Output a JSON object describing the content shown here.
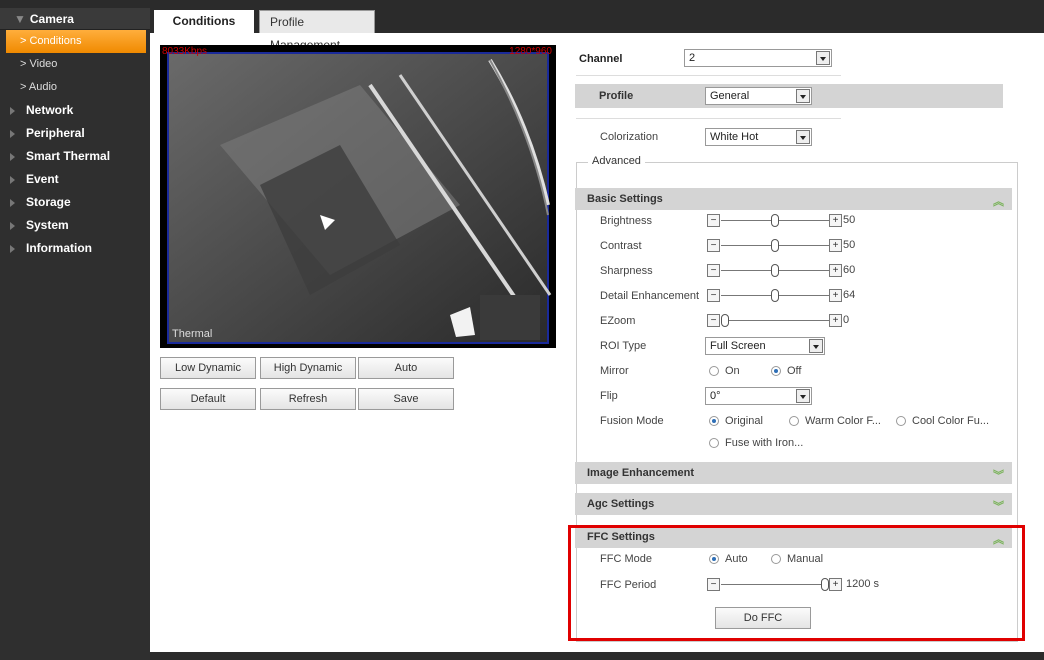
{
  "sidebar": {
    "header": "Camera",
    "subs": [
      "Conditions",
      "Video",
      "Audio"
    ],
    "items": [
      "Network",
      "Peripheral",
      "Smart Thermal",
      "Event",
      "Storage",
      "System",
      "Information"
    ]
  },
  "tabs": {
    "active": "Conditions",
    "inactive": "Profile Management"
  },
  "video": {
    "label": "Thermal",
    "bitrate": "8033Kbps",
    "resolution": "1280*960"
  },
  "video_buttons": {
    "low_dynamic": "Low Dynamic",
    "high_dynamic": "High Dynamic",
    "auto": "Auto",
    "default": "Default",
    "refresh": "Refresh",
    "save": "Save"
  },
  "form": {
    "channel_label": "Channel",
    "channel_value": "2",
    "profile_label": "Profile",
    "profile_value": "General",
    "colorization_label": "Colorization",
    "colorization_value": "White Hot",
    "advanced_legend": "Advanced"
  },
  "basic": {
    "title": "Basic Settings",
    "brightness": {
      "label": "Brightness",
      "value": "50",
      "level": 0.5
    },
    "contrast": {
      "label": "Contrast",
      "value": "50",
      "level": 0.5
    },
    "sharpness": {
      "label": "Sharpness",
      "value": "60",
      "level": 0.5
    },
    "detail": {
      "label": "Detail Enhancement",
      "value": "64",
      "level": 0.5
    },
    "ezoom": {
      "label": "EZoom",
      "value": "0",
      "level": 0.0
    },
    "roi_label": "ROI Type",
    "roi_value": "Full Screen",
    "mirror_label": "Mirror",
    "mirror_on": "On",
    "mirror_off": "Off",
    "flip_label": "Flip",
    "flip_value": "0°",
    "fusion_label": "Fusion Mode",
    "fusion_original": "Original",
    "fusion_warm": "Warm Color F...",
    "fusion_cool": "Cool Color Fu...",
    "fusion_iron": "Fuse with Iron..."
  },
  "sections": {
    "image_enhancement": "Image Enhancement",
    "agc": "Agc Settings"
  },
  "ffc": {
    "title": "FFC Settings",
    "mode_label": "FFC Mode",
    "mode_auto": "Auto",
    "mode_manual": "Manual",
    "period_label": "FFC Period",
    "period_value": "1200",
    "period_unit": "s",
    "period_level": 1.0,
    "do_ffc": "Do FFC"
  }
}
